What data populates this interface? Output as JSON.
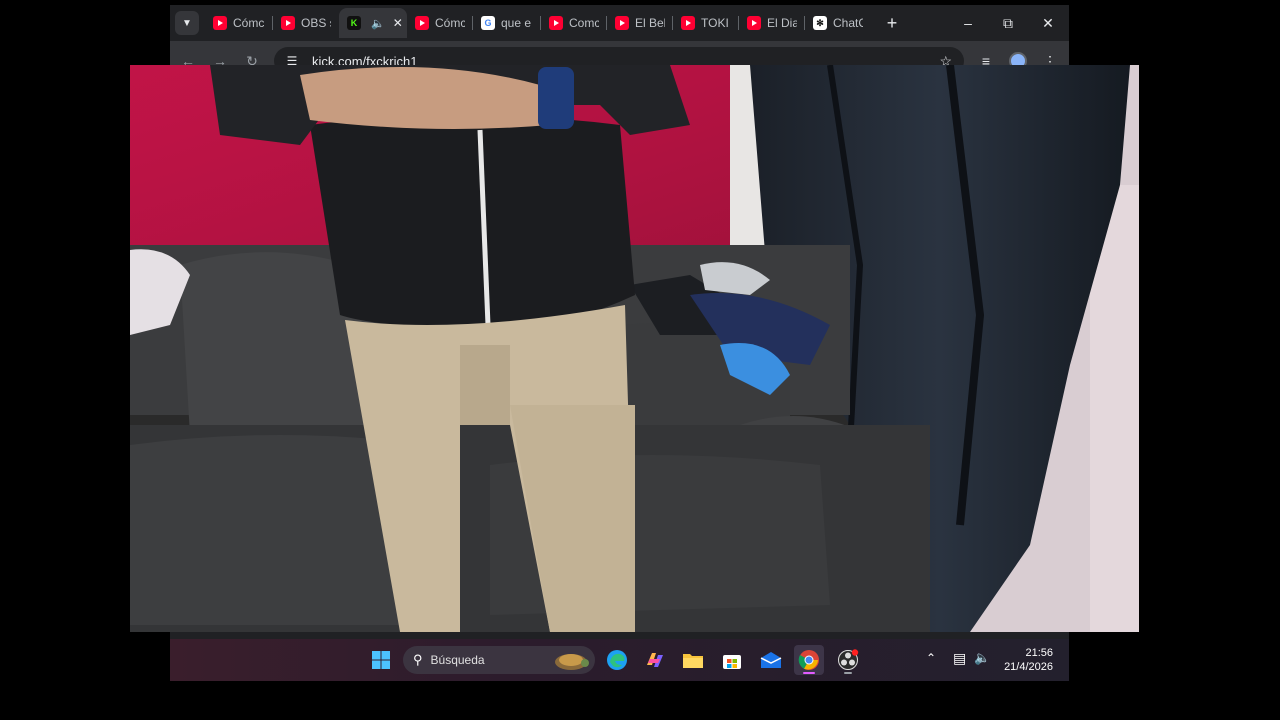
{
  "browser": {
    "tabs": [
      {
        "title": "Cómc",
        "favicon": "youtube-icon",
        "active": false
      },
      {
        "title": "OBS s",
        "favicon": "youtube-icon",
        "active": false
      },
      {
        "title": "",
        "favicon": "kick-icon",
        "active": true,
        "audio": "speaker-icon"
      },
      {
        "title": "Cómc",
        "favicon": "youtube-icon",
        "active": false
      },
      {
        "title": "que e",
        "favicon": "google-icon",
        "active": false
      },
      {
        "title": "Comc",
        "favicon": "youtube-icon",
        "active": false
      },
      {
        "title": "El Bel",
        "favicon": "youtube-icon",
        "active": false
      },
      {
        "title": "TOKI",
        "favicon": "youtube-icon",
        "active": false
      },
      {
        "title": "El Dia",
        "favicon": "youtube-icon",
        "active": false
      },
      {
        "title": "ChatC",
        "favicon": "chatgpt-icon",
        "active": false
      }
    ],
    "url": "kick.com/fxckrich1"
  },
  "video": {
    "description_icon": "live-video-feed"
  },
  "taskbar": {
    "search_label": "Búsqueda",
    "apps": [
      "windows-start-icon",
      "edge-icon",
      "copilot-icon",
      "file-explorer-icon",
      "store-icon",
      "outlook-icon",
      "chrome-icon",
      "obs-icon"
    ],
    "clock": {
      "time": "21:56",
      "date": "21/4/2026"
    }
  },
  "colors": {
    "tabstrip": "#202124",
    "toolbar": "#35363a",
    "youtube_red": "#ff0033",
    "kick_green": "#53fc18"
  }
}
